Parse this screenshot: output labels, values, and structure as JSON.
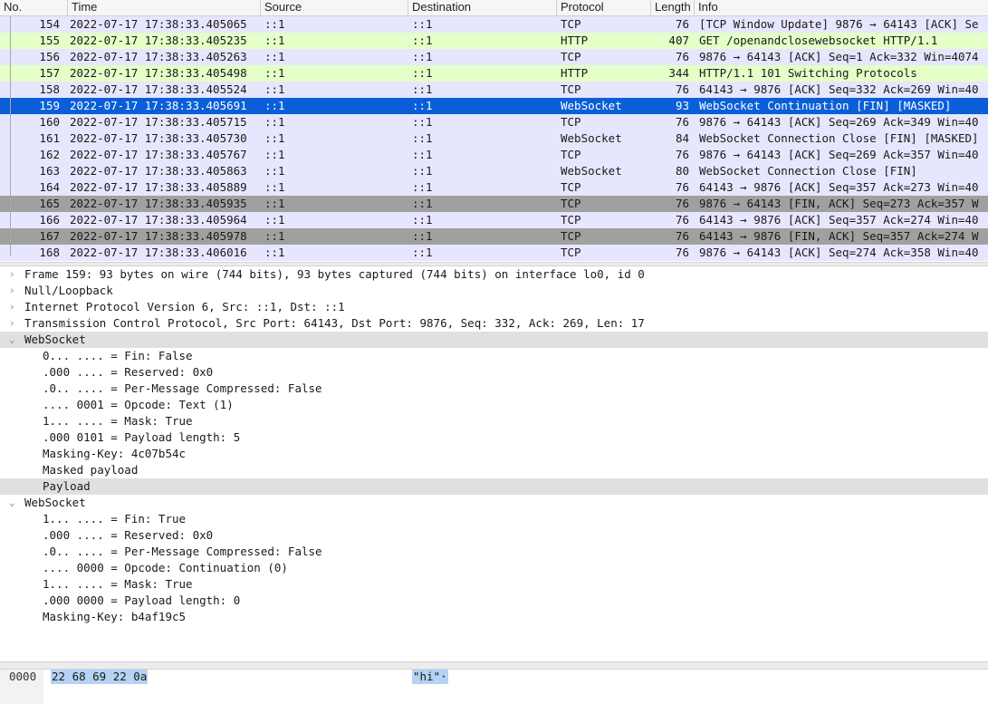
{
  "columns": {
    "no": "No.",
    "time": "Time",
    "source": "Source",
    "destination": "Destination",
    "protocol": "Protocol",
    "length": "Length",
    "info": "Info"
  },
  "packets": [
    {
      "no": "154",
      "time": "2022-07-17 17:38:33.405065",
      "src": "::1",
      "dst": "::1",
      "proto": "TCP",
      "len": "76",
      "info": "[TCP Window Update] 9876 → 64143 [ACK] Se",
      "style": "tcp"
    },
    {
      "no": "155",
      "time": "2022-07-17 17:38:33.405235",
      "src": "::1",
      "dst": "::1",
      "proto": "HTTP",
      "len": "407",
      "info": "GET /openandclosewebsocket HTTP/1.1",
      "style": "http"
    },
    {
      "no": "156",
      "time": "2022-07-17 17:38:33.405263",
      "src": "::1",
      "dst": "::1",
      "proto": "TCP",
      "len": "76",
      "info": "9876 → 64143 [ACK] Seq=1 Ack=332 Win=4074",
      "style": "tcp"
    },
    {
      "no": "157",
      "time": "2022-07-17 17:38:33.405498",
      "src": "::1",
      "dst": "::1",
      "proto": "HTTP",
      "len": "344",
      "info": "HTTP/1.1 101 Switching Protocols",
      "style": "http"
    },
    {
      "no": "158",
      "time": "2022-07-17 17:38:33.405524",
      "src": "::1",
      "dst": "::1",
      "proto": "TCP",
      "len": "76",
      "info": "64143 → 9876 [ACK] Seq=332 Ack=269 Win=40",
      "style": "tcp"
    },
    {
      "no": "159",
      "time": "2022-07-17 17:38:33.405691",
      "src": "::1",
      "dst": "::1",
      "proto": "WebSocket",
      "len": "93",
      "info": "WebSocket Continuation [FIN] [MASKED]",
      "style": "sel"
    },
    {
      "no": "160",
      "time": "2022-07-17 17:38:33.405715",
      "src": "::1",
      "dst": "::1",
      "proto": "TCP",
      "len": "76",
      "info": "9876 → 64143 [ACK] Seq=269 Ack=349 Win=40",
      "style": "tcp"
    },
    {
      "no": "161",
      "time": "2022-07-17 17:38:33.405730",
      "src": "::1",
      "dst": "::1",
      "proto": "WebSocket",
      "len": "84",
      "info": "WebSocket Connection Close [FIN] [MASKED]",
      "style": "ws"
    },
    {
      "no": "162",
      "time": "2022-07-17 17:38:33.405767",
      "src": "::1",
      "dst": "::1",
      "proto": "TCP",
      "len": "76",
      "info": "9876 → 64143 [ACK] Seq=269 Ack=357 Win=40",
      "style": "tcp"
    },
    {
      "no": "163",
      "time": "2022-07-17 17:38:33.405863",
      "src": "::1",
      "dst": "::1",
      "proto": "WebSocket",
      "len": "80",
      "info": "WebSocket Connection Close [FIN]",
      "style": "ws"
    },
    {
      "no": "164",
      "time": "2022-07-17 17:38:33.405889",
      "src": "::1",
      "dst": "::1",
      "proto": "TCP",
      "len": "76",
      "info": "64143 → 9876 [ACK] Seq=357 Ack=273 Win=40",
      "style": "tcp"
    },
    {
      "no": "165",
      "time": "2022-07-17 17:38:33.405935",
      "src": "::1",
      "dst": "::1",
      "proto": "TCP",
      "len": "76",
      "info": "9876 → 64143 [FIN, ACK] Seq=273 Ack=357 W",
      "style": "fin"
    },
    {
      "no": "166",
      "time": "2022-07-17 17:38:33.405964",
      "src": "::1",
      "dst": "::1",
      "proto": "TCP",
      "len": "76",
      "info": "64143 → 9876 [ACK] Seq=357 Ack=274 Win=40",
      "style": "tcp"
    },
    {
      "no": "167",
      "time": "2022-07-17 17:38:33.405978",
      "src": "::1",
      "dst": "::1",
      "proto": "TCP",
      "len": "76",
      "info": "64143 → 9876 [FIN, ACK] Seq=357 Ack=274 W",
      "style": "fin"
    },
    {
      "no": "168",
      "time": "2022-07-17 17:38:33.406016",
      "src": "::1",
      "dst": "::1",
      "proto": "TCP",
      "len": "76",
      "info": "9876 → 64143 [ACK] Seq=274 Ack=358 Win=40",
      "style": "tcp"
    }
  ],
  "details": [
    {
      "text": "Frame 159: 93 bytes on wire (744 bits), 93 bytes captured (744 bits) on interface lo0, id 0",
      "level": 0,
      "arrow": "collapsed"
    },
    {
      "text": "Null/Loopback",
      "level": 0,
      "arrow": "collapsed"
    },
    {
      "text": "Internet Protocol Version 6, Src: ::1, Dst: ::1",
      "level": 0,
      "arrow": "collapsed"
    },
    {
      "text": "Transmission Control Protocol, Src Port: 64143, Dst Port: 9876, Seq: 332, Ack: 269, Len: 17",
      "level": 0,
      "arrow": "collapsed"
    },
    {
      "text": "WebSocket",
      "level": 0,
      "arrow": "expanded",
      "hl": true
    },
    {
      "text": "0... .... = Fin: False",
      "level": 1
    },
    {
      "text": ".000 .... = Reserved: 0x0",
      "level": 1
    },
    {
      "text": ".0.. .... = Per-Message Compressed: False",
      "level": 1
    },
    {
      "text": ".... 0001 = Opcode: Text (1)",
      "level": 1
    },
    {
      "text": "1... .... = Mask: True",
      "level": 1
    },
    {
      "text": ".000 0101 = Payload length: 5",
      "level": 1
    },
    {
      "text": "Masking-Key: 4c07b54c",
      "level": 1
    },
    {
      "text": "Masked payload",
      "level": 1
    },
    {
      "text": "Payload",
      "level": 1,
      "hl": true
    },
    {
      "text": "WebSocket",
      "level": 0,
      "arrow": "expanded"
    },
    {
      "text": "1... .... = Fin: True",
      "level": 1
    },
    {
      "text": ".000 .... = Reserved: 0x0",
      "level": 1
    },
    {
      "text": ".0.. .... = Per-Message Compressed: False",
      "level": 1
    },
    {
      "text": ".... 0000 = Opcode: Continuation (0)",
      "level": 1
    },
    {
      "text": "1... .... = Mask: True",
      "level": 1
    },
    {
      "text": ".000 0000 = Payload length: 0",
      "level": 1
    },
    {
      "text": "Masking-Key: b4af19c5",
      "level": 1
    }
  ],
  "bytes": {
    "offset": "0000",
    "hex": "22 68 69 22 0a",
    "ascii": "\"hi\"·"
  },
  "arrows": {
    "collapsed": "›",
    "expanded": "⌄"
  }
}
